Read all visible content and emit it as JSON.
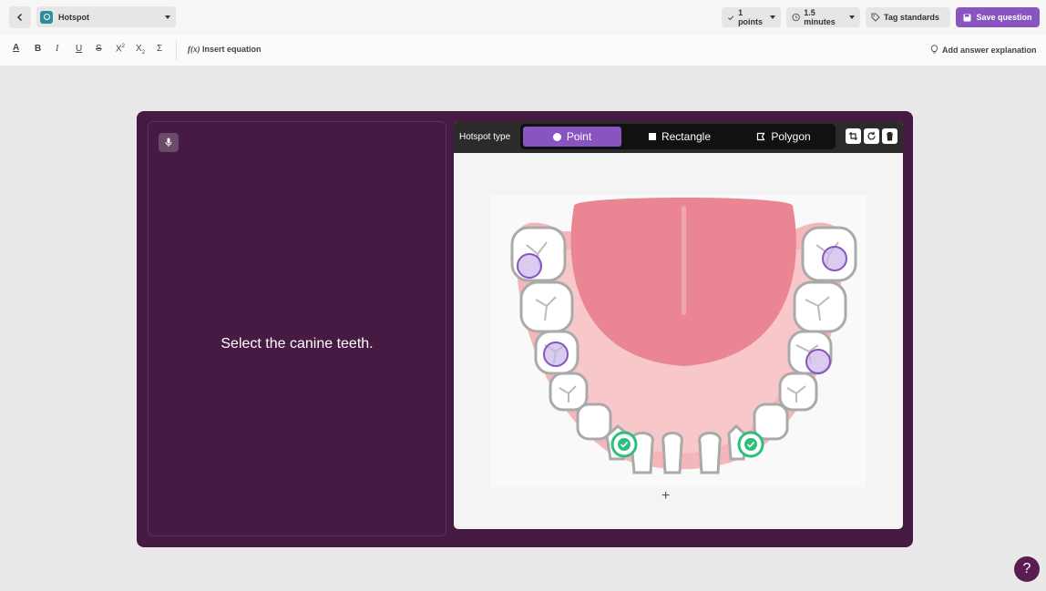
{
  "topbar": {
    "question_type": "Hotspot",
    "points": "1 points",
    "time": "1.5 minutes",
    "tag_label": "Tag standards",
    "save_label": "Save question"
  },
  "format_toolbar": {
    "insert_equation": "Insert equation",
    "add_explanation": "Add answer explanation"
  },
  "question": {
    "text": "Select the canine teeth."
  },
  "hotspot": {
    "type_label": "Hotspot type",
    "options": [
      "Point",
      "Rectangle",
      "Polygon"
    ],
    "selected": "Point",
    "markers": [
      {
        "state": "unselected"
      },
      {
        "state": "unselected"
      },
      {
        "state": "unselected"
      },
      {
        "state": "unselected"
      },
      {
        "state": "correct"
      },
      {
        "state": "correct"
      }
    ]
  },
  "colors": {
    "accent": "#8854c0",
    "card": "#461a42",
    "correct": "#2fbf7d"
  }
}
